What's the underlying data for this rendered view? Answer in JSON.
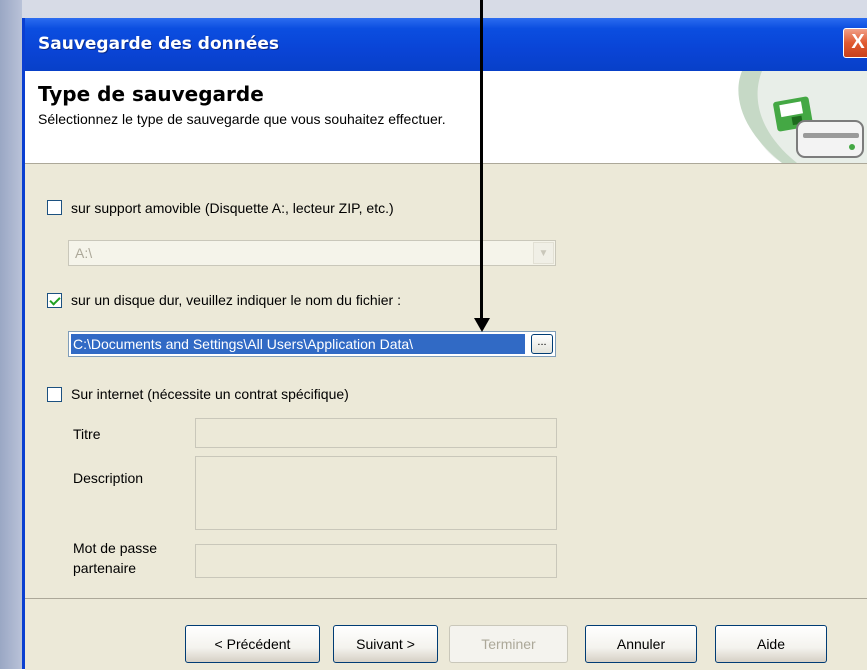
{
  "window": {
    "title": "Sauvegarde des données",
    "close_label": "X"
  },
  "header": {
    "title": "Type de sauvegarde",
    "subtitle": "Sélectionnez le type de sauvegarde que vous souhaitez effectuer."
  },
  "options": {
    "removable": {
      "label": "sur support amovible (Disquette A:, lecteur ZIP, etc.)",
      "checked": false,
      "drive_value": "A:\\"
    },
    "harddisk": {
      "label": "sur un disque dur, veuillez indiquer le nom du fichier :",
      "checked": true,
      "path_value": "C:\\Documents and Settings\\All Users\\Application Data\\",
      "browse_label": "..."
    },
    "internet": {
      "label": "Sur internet (nécessite un contrat spécifique)",
      "checked": false,
      "title_label": "Titre",
      "description_label": "Description",
      "password_label_line1": "Mot de passe",
      "password_label_line2": "partenaire"
    }
  },
  "buttons": {
    "previous": "< Précédent",
    "next": "Suivant >",
    "finish": "Terminer",
    "cancel": "Annuler",
    "help": "Aide"
  }
}
